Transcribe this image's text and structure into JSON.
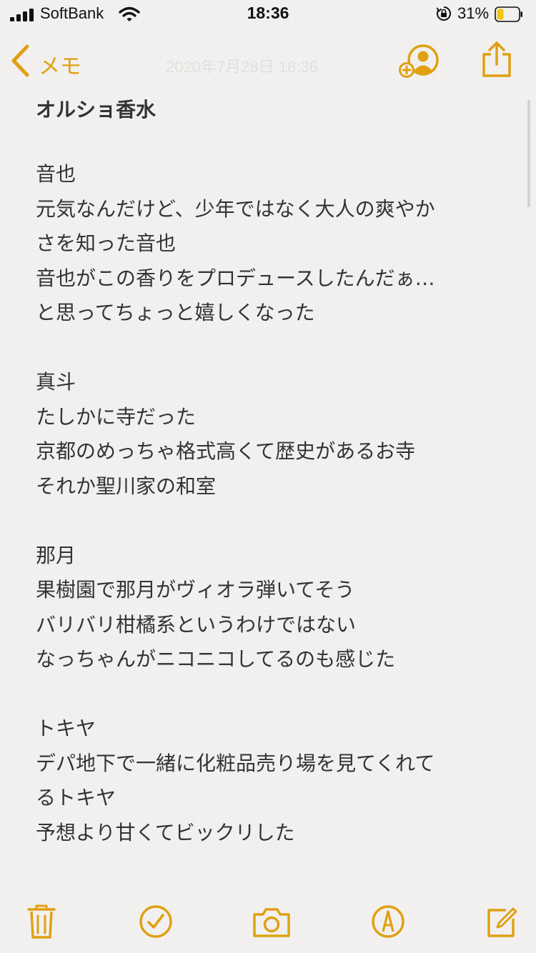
{
  "status_bar": {
    "carrier": "SoftBank",
    "time": "18:36",
    "battery_percent": "31%",
    "battery_level": 0.31,
    "icons": [
      "signal-icon",
      "wifi-icon",
      "orientation-lock-icon",
      "battery-icon"
    ]
  },
  "nav": {
    "back_label": "メモ",
    "date": "2020年7月28日 18:36",
    "icons": [
      "chevron-left-icon",
      "add-person-icon",
      "share-icon"
    ]
  },
  "note": {
    "title": "オルショ香水",
    "sections": [
      {
        "lines": [
          "音也",
          "元気なんだけど、少年ではなく大人の爽やか",
          "さを知った音也",
          "音也がこの香りをプロデュースしたんだぁ…",
          "と思ってちょっと嬉しくなった"
        ]
      },
      {
        "lines": [
          "真斗",
          "たしかに寺だった",
          "京都のめっちゃ格式高くて歴史があるお寺",
          "それか聖川家の和室"
        ]
      },
      {
        "lines": [
          "那月",
          "果樹園で那月がヴィオラ弾いてそう",
          "バリバリ柑橘系というわけではない",
          "なっちゃんがニコニコしてるのも感じた"
        ]
      },
      {
        "lines": [
          "トキヤ",
          "デパ地下で一緒に化粧品売り場を見てくれて",
          "るトキヤ",
          "予想より甘くてビックリした"
        ]
      }
    ]
  },
  "toolbar": {
    "icons": [
      "trash-icon",
      "checklist-icon",
      "camera-icon",
      "markup-pen-icon",
      "compose-icon"
    ]
  },
  "colors": {
    "accent": "#e0a012",
    "text": "#333333",
    "background": "#f3f2f0"
  }
}
